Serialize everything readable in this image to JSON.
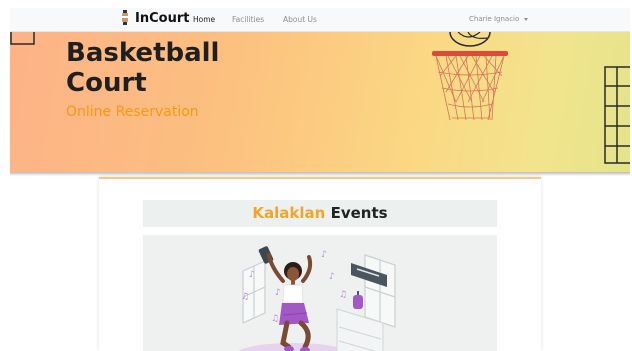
{
  "navbar": {
    "brand": "InCourt",
    "links": [
      {
        "label": "Home",
        "active": true
      },
      {
        "label": "Facilities",
        "active": false
      },
      {
        "label": "About Us",
        "active": false
      }
    ],
    "user": "Charie Ignacio"
  },
  "hero": {
    "title_line1": "Basketball",
    "title_line2": "Court",
    "subtitle": "Online Reservation"
  },
  "event": {
    "title_accent": "Kalaklan",
    "title_rest": " Events"
  },
  "colors": {
    "accent": "#f39a12",
    "navbar_bg": "#f8f9fa",
    "hero_start": "#fdb287",
    "hero_end": "#e4e48b",
    "illustration_purple": "#a259c6"
  }
}
